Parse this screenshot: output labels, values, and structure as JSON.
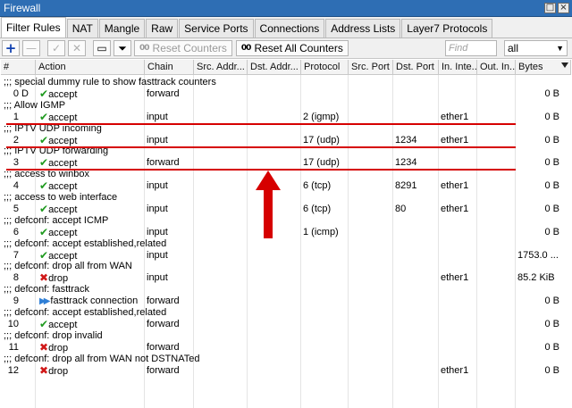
{
  "window": {
    "title": "Firewall"
  },
  "tabs": [
    "Filter Rules",
    "NAT",
    "Mangle",
    "Raw",
    "Service Ports",
    "Connections",
    "Address Lists",
    "Layer7 Protocols"
  ],
  "toolbar": {
    "reset_counters": "Reset Counters",
    "reset_all_counters": "Reset All Counters",
    "find_placeholder": "Find",
    "filter_value": "all"
  },
  "columns": [
    "#",
    "Action",
    "Chain",
    "Src. Addr...",
    "Dst. Addr...",
    "Protocol",
    "Src. Port",
    "Dst. Port",
    "In. Inte...",
    "Out. In...",
    "Bytes"
  ],
  "rules": [
    {
      "comment": ";;; special dummy rule to show fasttrack counters",
      "num": "0",
      "flag": "D",
      "action": "accept",
      "icon": "check-icon",
      "chain": "forward",
      "src": "",
      "dst": "",
      "protocol": "",
      "sport": "",
      "dport": "",
      "in": "",
      "out": "",
      "bytes": "0 B"
    },
    {
      "comment": ";;; Allow IGMP",
      "num": "1",
      "flag": "",
      "action": "accept",
      "icon": "check-icon",
      "chain": "input",
      "src": "",
      "dst": "",
      "protocol": "2 (igmp)",
      "sport": "",
      "dport": "",
      "in": "ether1",
      "out": "",
      "bytes": "0 B"
    },
    {
      "comment": ";;; IPTV UDP incoming",
      "num": "2",
      "flag": "",
      "action": "accept",
      "icon": "check-icon",
      "chain": "input",
      "src": "",
      "dst": "",
      "protocol": "17 (udp)",
      "sport": "",
      "dport": "1234",
      "in": "ether1",
      "out": "",
      "bytes": "0 B"
    },
    {
      "comment": ";;; IPTV UDP forwarding",
      "num": "3",
      "flag": "",
      "action": "accept",
      "icon": "check-icon",
      "chain": "forward",
      "src": "",
      "dst": "",
      "protocol": "17 (udp)",
      "sport": "",
      "dport": "1234",
      "in": "",
      "out": "",
      "bytes": "0 B"
    },
    {
      "comment": ";;; access to winbox",
      "num": "4",
      "flag": "",
      "action": "accept",
      "icon": "check-icon",
      "chain": "input",
      "src": "",
      "dst": "",
      "protocol": "6 (tcp)",
      "sport": "",
      "dport": "8291",
      "in": "ether1",
      "out": "",
      "bytes": "0 B"
    },
    {
      "comment": ";;; access to web interface",
      "num": "5",
      "flag": "",
      "action": "accept",
      "icon": "check-icon",
      "chain": "input",
      "src": "",
      "dst": "",
      "protocol": "6 (tcp)",
      "sport": "",
      "dport": "80",
      "in": "ether1",
      "out": "",
      "bytes": "0 B"
    },
    {
      "comment": ";;; defconf: accept ICMP",
      "num": "6",
      "flag": "",
      "action": "accept",
      "icon": "check-icon",
      "chain": "input",
      "src": "",
      "dst": "",
      "protocol": "1 (icmp)",
      "sport": "",
      "dport": "",
      "in": "",
      "out": "",
      "bytes": "0 B"
    },
    {
      "comment": ";;; defconf: accept established,related",
      "num": "7",
      "flag": "",
      "action": "accept",
      "icon": "check-icon",
      "chain": "input",
      "src": "",
      "dst": "",
      "protocol": "",
      "sport": "",
      "dport": "",
      "in": "",
      "out": "",
      "bytes": "1753.0 ..."
    },
    {
      "comment": ";;; defconf: drop all from WAN",
      "num": "8",
      "flag": "",
      "action": "drop",
      "icon": "cross-icon",
      "chain": "input",
      "src": "",
      "dst": "",
      "protocol": "",
      "sport": "",
      "dport": "",
      "in": "ether1",
      "out": "",
      "bytes": "85.2 KiB"
    },
    {
      "comment": ";;; defconf: fasttrack",
      "num": "9",
      "flag": "",
      "action": "fasttrack connection",
      "icon": "fasttrack-icon",
      "chain": "forward",
      "src": "",
      "dst": "",
      "protocol": "",
      "sport": "",
      "dport": "",
      "in": "",
      "out": "",
      "bytes": "0 B"
    },
    {
      "comment": ";;; defconf: accept established,related",
      "num": "10",
      "flag": "",
      "action": "accept",
      "icon": "check-icon",
      "chain": "forward",
      "src": "",
      "dst": "",
      "protocol": "",
      "sport": "",
      "dport": "",
      "in": "",
      "out": "",
      "bytes": "0 B"
    },
    {
      "comment": ";;; defconf: drop invalid",
      "num": "11",
      "flag": "",
      "action": "drop",
      "icon": "cross-icon",
      "chain": "forward",
      "src": "",
      "dst": "",
      "protocol": "",
      "sport": "",
      "dport": "",
      "in": "",
      "out": "",
      "bytes": "0 B"
    },
    {
      "comment": ";;; defconf:  drop all from WAN not DSTNATed",
      "num": "12",
      "flag": "",
      "action": "drop",
      "icon": "cross-icon",
      "chain": "forward",
      "src": "",
      "dst": "",
      "protocol": "",
      "sport": "",
      "dport": "",
      "in": "ether1",
      "out": "",
      "bytes": "0 B"
    }
  ],
  "annotation": {
    "color": "#d60000",
    "highlighted_rules": [
      "1",
      "2",
      "3"
    ]
  }
}
